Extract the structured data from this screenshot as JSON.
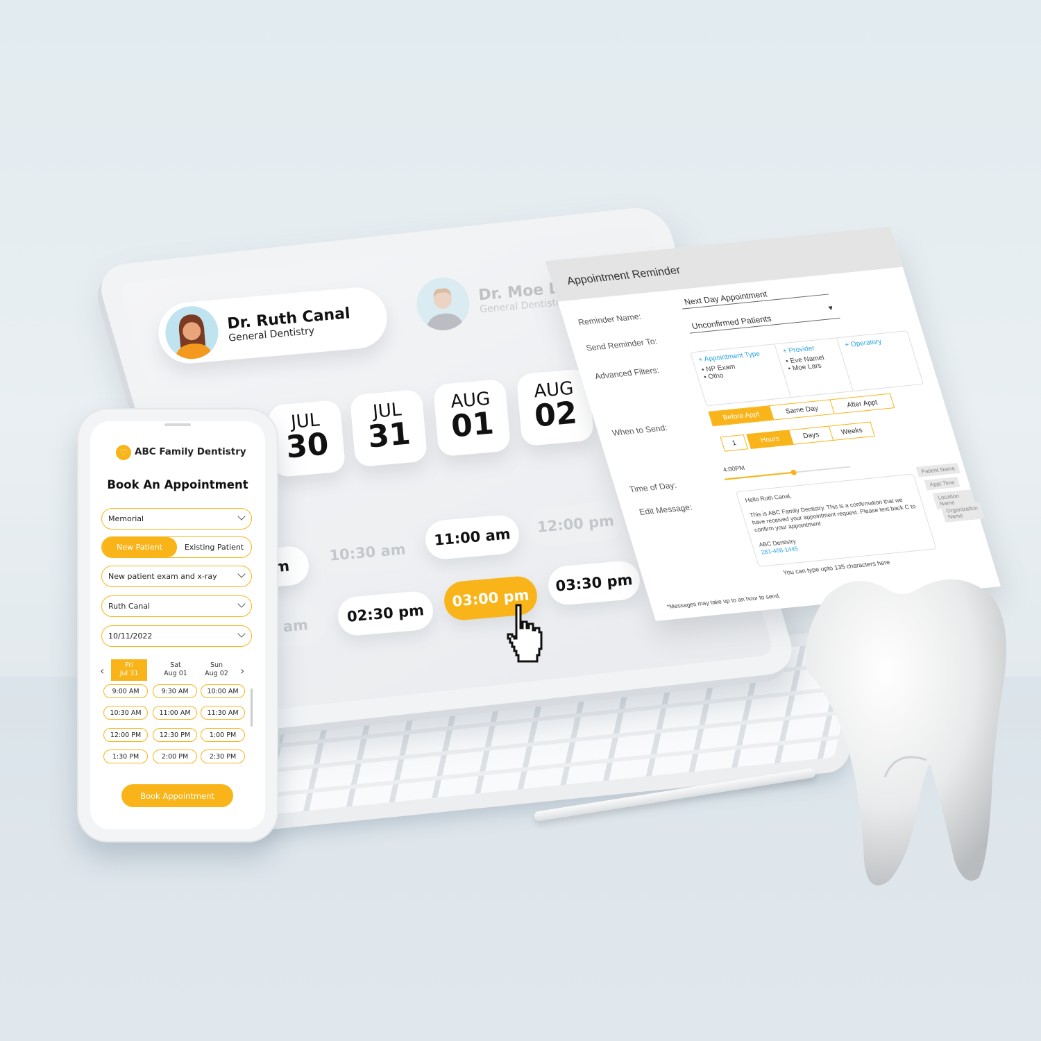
{
  "colors": {
    "accent": "#f8b418",
    "link": "#2aa4e0",
    "background": "#e2ebf0"
  },
  "tablet": {
    "doctors": [
      {
        "name": "Dr. Ruth Canal",
        "specialty": "General Dentistry"
      },
      {
        "name": "Dr. Moe Lars",
        "specialty": "General Dentistry"
      }
    ],
    "dates": [
      {
        "month": "JUL",
        "day": "30"
      },
      {
        "month": "JUL",
        "day": "31"
      },
      {
        "month": "AUG",
        "day": "01"
      },
      {
        "month": "AUG",
        "day": "02"
      }
    ],
    "times": {
      "partial_a": "m",
      "t1030": "10:30 am",
      "t1100": "11:00 am",
      "t1200": "12:00 pm",
      "partial_b": "0 am",
      "t0230": "02:30 pm",
      "t0300": "03:00 pm",
      "t0330": "03:30 pm"
    },
    "cursor_icon": "pointing-hand-cursor"
  },
  "reminder": {
    "title": "Appointment Reminder",
    "name_label": "Reminder Name:",
    "name_value": "Next Day Appointment",
    "send_to_label": "Send Reminder To:",
    "send_to_value": "Unconfirmed Patients",
    "filters_label": "Advanced Filters:",
    "filters": [
      {
        "title": "+ Appointment Type",
        "items": [
          "NP Exam",
          "Otho"
        ]
      },
      {
        "title": "+ Provider",
        "items": [
          "Eve Namel",
          "Moe Lars"
        ]
      },
      {
        "title": "+ Operatory",
        "items": []
      }
    ],
    "when_label": "When to Send:",
    "when_options": [
      "Before Appt",
      "Same Day",
      "After Appt"
    ],
    "when_selected": "Before Appt",
    "amount": "1",
    "unit_options": [
      "Hours",
      "Days",
      "Weeks"
    ],
    "unit_selected": "Hours",
    "time_label": "Time of Day:",
    "time_value": "4:00PM",
    "time_slider_fraction": 0.55,
    "message_label": "Edit Message:",
    "message": {
      "greeting": "Hello Ruth Canal,",
      "body": "This is ABC Family Dentistry. This is a confirmation that we have received your appointment request. Please text back C to confirm your appointment",
      "signature": "ABC Dentistry",
      "phone": "281-468-1445"
    },
    "tags": [
      "Patient Name",
      "Appt Time",
      "Location Name",
      "Organization Name"
    ],
    "char_hint": "You can type upto 135 characters here",
    "footnote": "*Messages may take up to an hour to send."
  },
  "phone": {
    "brand": "ABC Family Dentistry",
    "heading": "Book An Appointment",
    "location": "Memorial",
    "patient_types": [
      "New Patient",
      "Existing Patient"
    ],
    "patient_selected": "New Patient",
    "reason": "New patient exam and x-ray",
    "provider": "Ruth Canal",
    "date": "10/11/2022",
    "days": [
      {
        "dow": "Fri",
        "date": "Jul 31"
      },
      {
        "dow": "Sat",
        "date": "Aug 01"
      },
      {
        "dow": "Sun",
        "date": "Aug 02"
      }
    ],
    "selected_day": "Fri Jul 31",
    "slots": [
      "9:00 AM",
      "9:30 AM",
      "10:00 AM",
      "10:30 AM",
      "11:00 AM",
      "11:30 AM",
      "12:00 PM",
      "12:30 PM",
      "1:00 PM",
      "1:30 PM",
      "2:00 PM",
      "2:30 PM"
    ],
    "book_button": "Book Appointment"
  }
}
